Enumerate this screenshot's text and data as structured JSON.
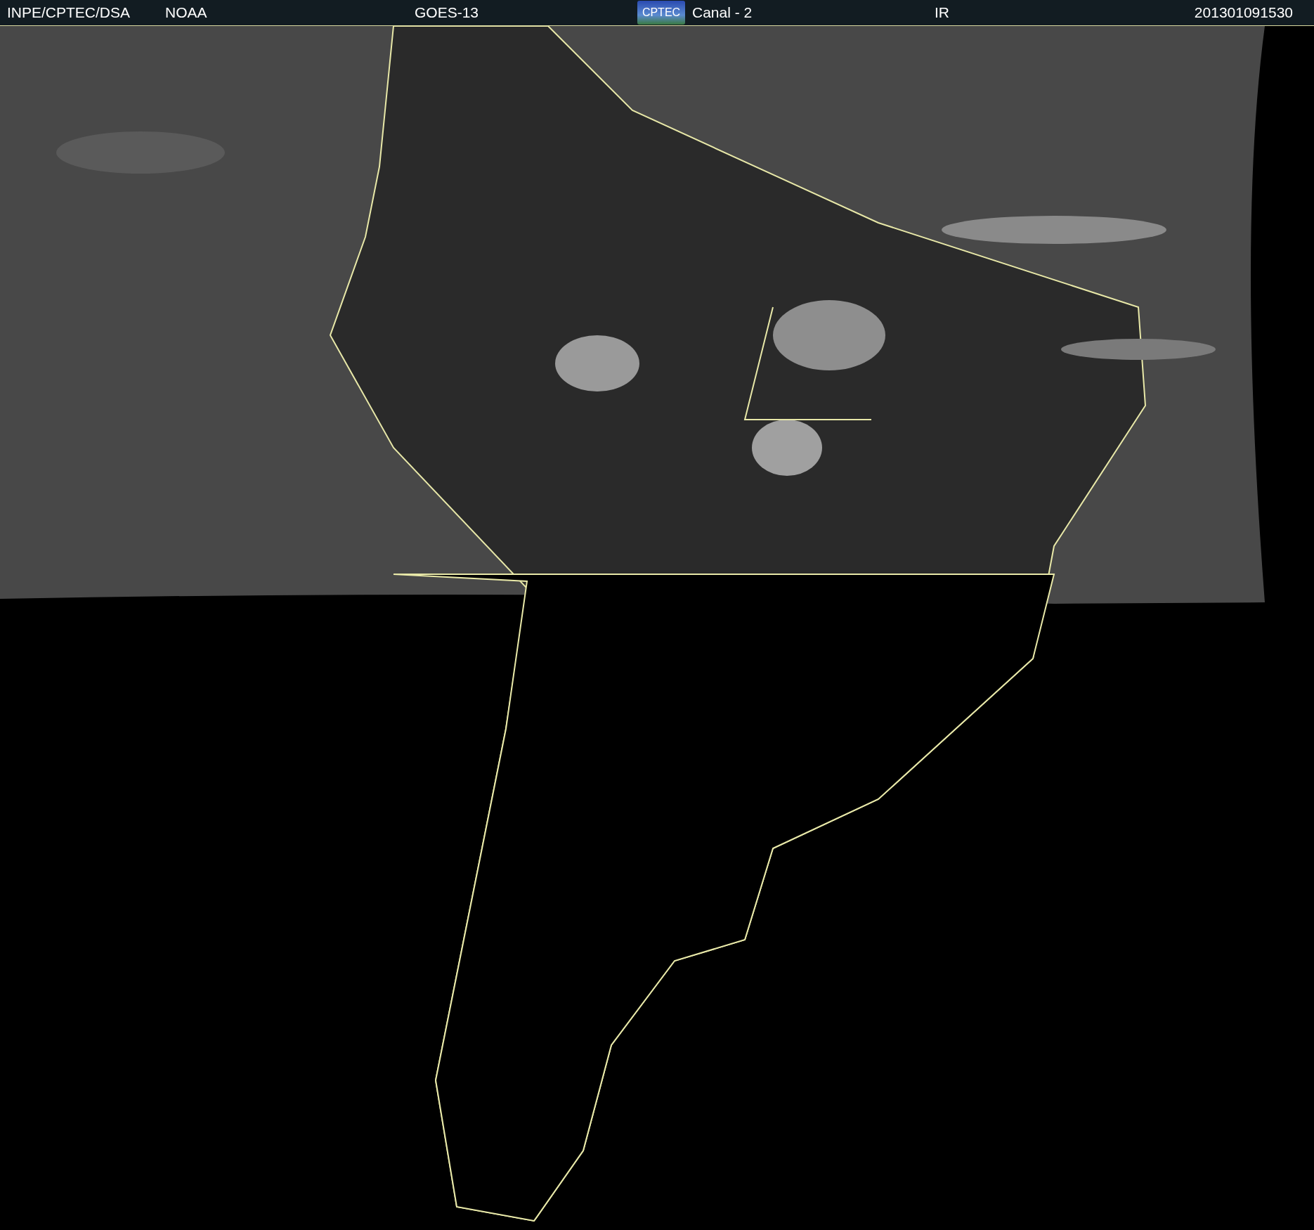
{
  "header": {
    "source": "INPE/CPTEC/DSA",
    "agency": "NOAA",
    "satellite": "GOES-13",
    "logo": "CPTEC",
    "channel": "Canal - 2",
    "band": "IR",
    "timestamp": "201301091530"
  }
}
